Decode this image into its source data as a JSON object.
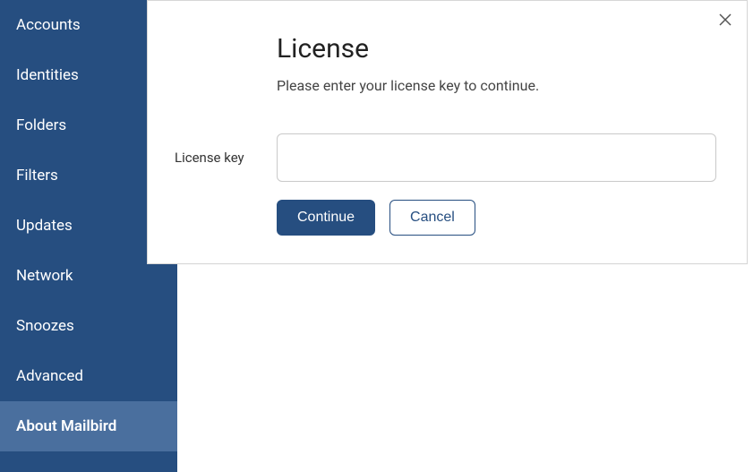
{
  "sidebar": {
    "items": [
      {
        "label": "Accounts",
        "active": false
      },
      {
        "label": "Identities",
        "active": false
      },
      {
        "label": "Folders",
        "active": false
      },
      {
        "label": "Filters",
        "active": false
      },
      {
        "label": "Updates",
        "active": false
      },
      {
        "label": "Network",
        "active": false
      },
      {
        "label": "Snoozes",
        "active": false
      },
      {
        "label": "Advanced",
        "active": false
      },
      {
        "label": "About Mailbird",
        "active": true
      }
    ]
  },
  "dialog": {
    "title": "License",
    "subtitle": "Please enter your license key to continue.",
    "field_label": "License key",
    "field_value": "",
    "continue_label": "Continue",
    "cancel_label": "Cancel"
  }
}
